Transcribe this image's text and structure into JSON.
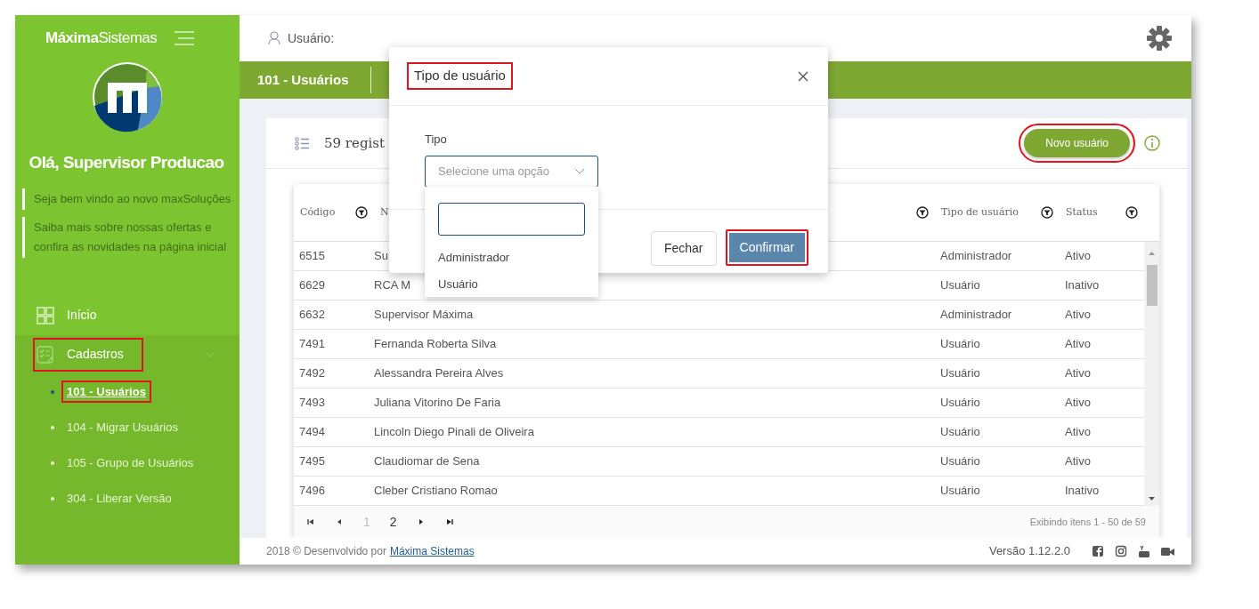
{
  "sidebar": {
    "brand_bold": "Máxima",
    "brand_light": "Sistemas",
    "greeting": "Olá, Supervisor Producao",
    "notes": [
      "Seja bem vindo ao novo maxSoluções",
      "Saiba mais sobre nossas ofertas e confira as novidades na página inicial"
    ],
    "menu": [
      {
        "label": "Início",
        "kind": "home",
        "highlighted": false
      },
      {
        "label": "Cadastros",
        "kind": "forms",
        "expanded": true,
        "highlighted": true,
        "children": [
          {
            "label": "101 - Usuários",
            "selected": true,
            "highlighted": true
          },
          {
            "label": "104 - Migrar Usuários",
            "selected": false,
            "highlighted": false
          },
          {
            "label": "105 - Grupo de Usuários",
            "selected": false,
            "highlighted": false
          },
          {
            "label": "304 - Liberar Versão",
            "selected": false,
            "highlighted": false
          }
        ]
      }
    ]
  },
  "topbar": {
    "user_label": "Usuário:"
  },
  "page_header": {
    "title": "101 - Usuários"
  },
  "card": {
    "record_count": "59 regist",
    "new_button": {
      "label": "Novo usuário",
      "highlighted": true
    }
  },
  "table": {
    "columns": [
      {
        "label": "Código"
      },
      {
        "label": "N"
      },
      {
        "label": "Tipo de usuário"
      },
      {
        "label": "Status"
      }
    ],
    "rows": [
      {
        "cells": [
          "6515",
          "Su",
          "Administrador",
          "Ativo"
        ]
      },
      {
        "cells": [
          "6629",
          "RCA M",
          "Usuário",
          "Inativo"
        ]
      },
      {
        "cells": [
          "6632",
          "Supervisor Máxima",
          "Administrador",
          "Ativo"
        ]
      },
      {
        "cells": [
          "7491",
          "Fernanda Roberta Silva",
          "Usuário",
          "Ativo"
        ]
      },
      {
        "cells": [
          "7492",
          "Alessandra Pereira Alves",
          "Usuário",
          "Ativo"
        ]
      },
      {
        "cells": [
          "7493",
          "Juliana Vitorino De Faria",
          "Usuário",
          "Ativo"
        ]
      },
      {
        "cells": [
          "7494",
          "Lincoln Diego Pinali de Oliveira",
          "Usuário",
          "Ativo"
        ]
      },
      {
        "cells": [
          "7495",
          "Claudiomar de Sena",
          "Usuário",
          "Ativo"
        ]
      },
      {
        "cells": [
          "7496",
          "Cleber Cristiano Romao",
          "Usuário",
          "Inativo"
        ]
      }
    ]
  },
  "pagination": {
    "pages": [
      {
        "label": "1",
        "selected": true
      },
      {
        "label": "2",
        "selected": false
      }
    ],
    "summary": "Exibindo itens 1 - 50 de 59"
  },
  "footer": {
    "credit": "2018 © Desenvolvido por",
    "link": "Máxima Sistemas",
    "version": "Versão 1.12.2.0"
  },
  "modal": {
    "title": "Tipo de usuário",
    "title_highlighted": true,
    "field_label": "Tipo",
    "placeholder": "Selecione uma opção",
    "open": true,
    "options": [
      "Administrador",
      "Usuário"
    ],
    "buttons": [
      {
        "label": "Fechar",
        "kind": "secondary",
        "highlighted": false
      },
      {
        "label": "Confirmar",
        "kind": "primary",
        "highlighted": true
      }
    ]
  }
}
